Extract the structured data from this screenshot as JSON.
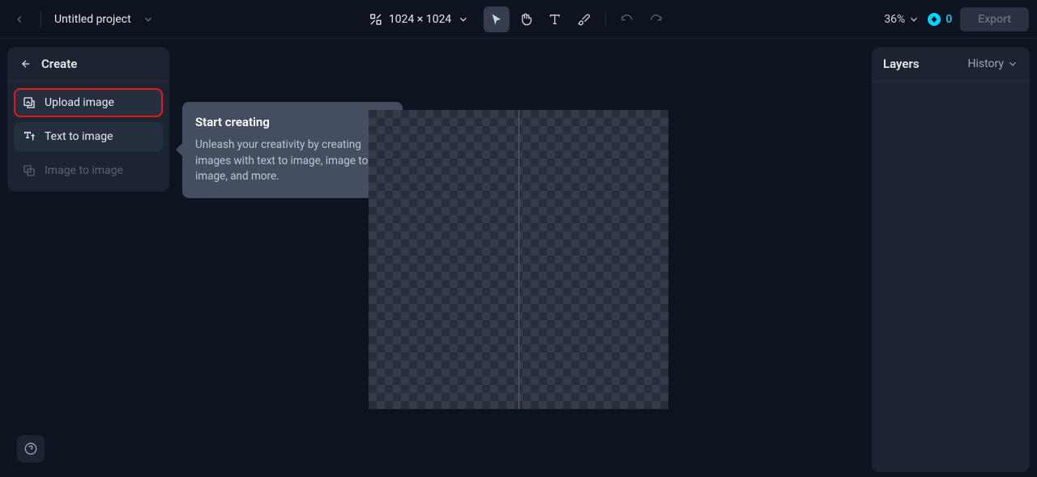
{
  "header": {
    "project_title": "Untitled project",
    "canvas_size": "1024 × 1024",
    "zoom": "36%",
    "credits": "0",
    "export_label": "Export"
  },
  "create_panel": {
    "title": "Create",
    "options": {
      "upload": "Upload image",
      "text_to_image": "Text to image",
      "image_to_image": "Image to image"
    }
  },
  "tooltip": {
    "title": "Start creating",
    "body": "Unleash your creativity by creating images with text to image, image to image, and more."
  },
  "right_panel": {
    "title": "Layers",
    "history_label": "History"
  }
}
